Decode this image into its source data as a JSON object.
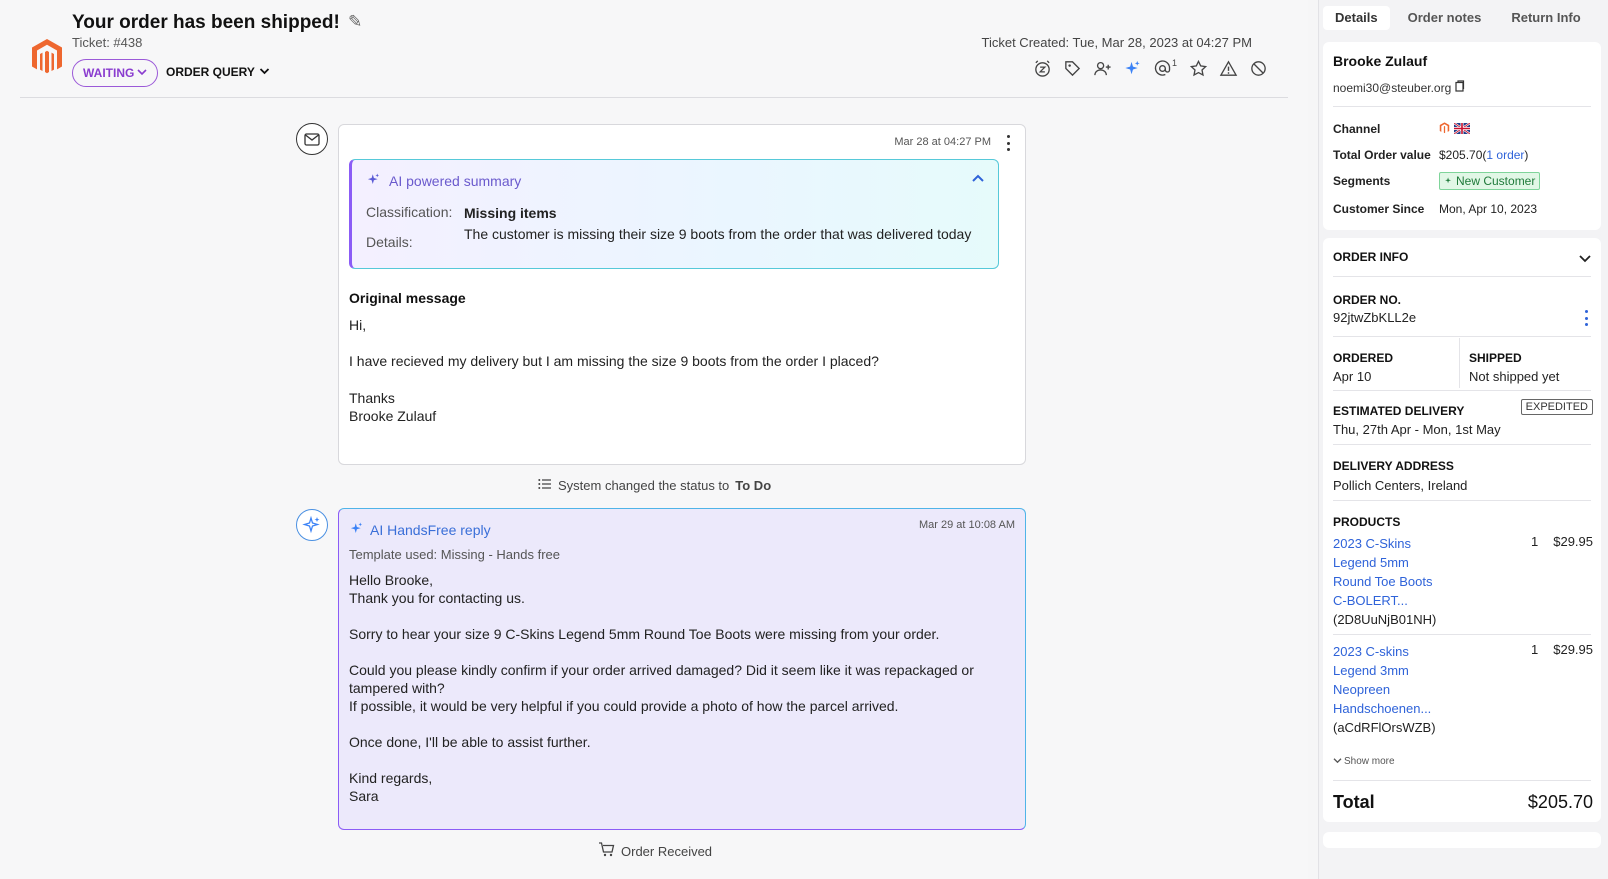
{
  "header": {
    "title": "Your order has been shipped!",
    "ticket": "Ticket: #438",
    "status": "WAITING",
    "query_type": "ORDER QUERY",
    "created": "Ticket Created: Tue, Mar 28, 2023 at 04:27 PM",
    "mention_count": "1"
  },
  "message": {
    "time": "Mar 28 at 04:27 PM",
    "ai_summary": {
      "title": "AI powered summary",
      "classification_label": "Classification:",
      "classification_value": "Missing items",
      "details_label": "Details:",
      "details_value": "The customer is missing their size 9 boots from the order that was delivered today"
    },
    "original_heading": "Original message",
    "lines": [
      "Hi,",
      "I have recieved my delivery but I am missing the size 9 boots from the order I placed?",
      "Thanks",
      "Brooke Zulauf"
    ]
  },
  "system_event": {
    "text": "System changed the status to",
    "status": "To Do"
  },
  "ai_reply": {
    "title": "AI HandsFree reply",
    "time": "Mar 29 at 10:08 AM",
    "template": "Template used: Missing - Hands free",
    "lines": [
      "Hello Brooke,",
      "Thank you for contacting us.",
      "Sorry to hear your size 9 C-Skins Legend 5mm Round Toe Boots were missing from your order.",
      "Could you please kindly confirm if your order arrived damaged? Did it seem like it was repackaged or",
      "tampered with?",
      "If possible, it would be very helpful if you could provide a photo of how the parcel arrived.",
      "Once done, I'll be able to assist further.",
      "Kind regards,",
      "Sara"
    ]
  },
  "order_event": {
    "text": "Order Received"
  },
  "sidebar": {
    "tabs": [
      "Details",
      "Order notes",
      "Return Info"
    ],
    "customer": {
      "name": "Brooke Zulauf",
      "email": "noemi30@steuber.org",
      "channel_label": "Channel",
      "total_label": "Total Order value",
      "total_value": "$205.70",
      "total_orders_link": "1 order",
      "segments_label": "Segments",
      "segment": "New Customer",
      "since_label": "Customer Since",
      "since_value": "Mon, Apr 10, 2023"
    },
    "order_info": {
      "title": "ORDER INFO",
      "order_no_label": "ORDER NO.",
      "order_no": "92jtwZbKLL2e",
      "ordered_label": "ORDERED",
      "ordered_value": "Apr 10",
      "shipped_label": "SHIPPED",
      "shipped_value": "Not shipped yet",
      "est_label": "ESTIMATED DELIVERY",
      "est_value": "Thu, 27th Apr - Mon, 1st May",
      "expedited": "EXPEDITED",
      "address_label": "DELIVERY ADDRESS",
      "address": "Pollich Centers, Ireland",
      "products_label": "PRODUCTS",
      "products": [
        {
          "name_lines": [
            "2023 C-Skins",
            "Legend 5mm",
            "Round Toe Boots",
            "C-BOLERT..."
          ],
          "sku": "(2D8UuNjB01NH)",
          "qty": "1",
          "price": "$29.95"
        },
        {
          "name_lines": [
            "2023 C-skins",
            "Legend 3mm",
            "Neopreen",
            "Handschoenen..."
          ],
          "sku": "(aCdRFlOrsWZB)",
          "qty": "1",
          "price": "$29.95"
        }
      ],
      "show_more": "Show more",
      "total_label": "Total",
      "total_value": "$205.70"
    }
  }
}
